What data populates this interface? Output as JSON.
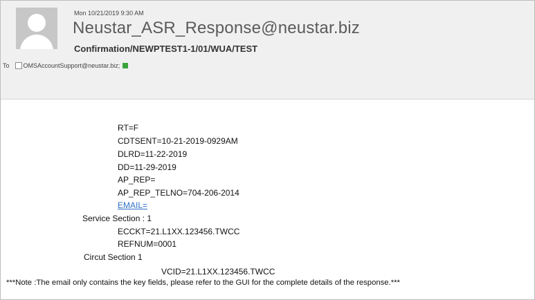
{
  "email": {
    "date": "Mon 10/21/2019 9:30 AM",
    "sender": "Neustar_ASR_Response@neustar.biz",
    "subject": "Confirmation/NEWPTEST1-1/01/WUA/TEST",
    "to_label": "To",
    "recipient": "OMSAccountSupport@neustar.biz;",
    "presence_color": "#3aa33a"
  },
  "body": {
    "rt": "RT=F",
    "cdtsent": "CDTSENT=10-21-2019-0929AM",
    "dlrd": "DLRD=11-22-2019",
    "dd": "DD=11-29-2019",
    "ap_rep": "AP_REP=",
    "ap_rep_telno": "AP_REP_TELNO=704-206-2014",
    "email_link": "EMAIL=",
    "service_section": "Service Section : 1",
    "ecckt": "ECCKT=21.L1XX.123456.TWCC",
    "refnum": "REFNUM=0001",
    "circuit_section": "Circut Section 1",
    "vcid": "VCID=21.L1XX.123456.TWCC",
    "note": "***Note :The email only contains the key fields, please refer to the GUI for the complete details of the response.***"
  }
}
